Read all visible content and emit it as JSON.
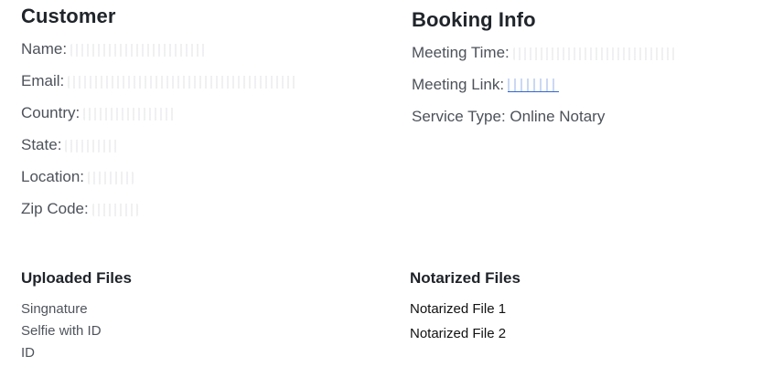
{
  "customer": {
    "title": "Customer",
    "fields": [
      {
        "label": "Name:"
      },
      {
        "label": "Email:"
      },
      {
        "label": "Country:"
      },
      {
        "label": "State:"
      },
      {
        "label": "Location:"
      },
      {
        "label": "Zip Code:"
      }
    ]
  },
  "booking": {
    "title": "Booking Info",
    "meeting_time_label": "Meeting Time:",
    "meeting_link_label": "Meeting Link:",
    "service_type_text": "Service Type: Online Notary"
  },
  "uploaded_files": {
    "title": "Uploaded Files",
    "items": [
      "Singnature",
      "Selfie with ID",
      "ID"
    ]
  },
  "notarized_files": {
    "title": "Notarized Files",
    "items": [
      "Notarized File 1",
      "Notarized File 2"
    ]
  },
  "colors": {
    "heading": "#20252b",
    "text": "#4d525a",
    "link": "#2f66d0"
  }
}
